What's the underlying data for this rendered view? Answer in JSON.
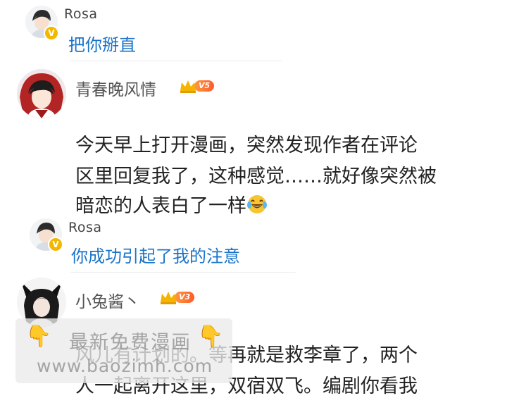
{
  "replies": [
    {
      "author": "Rosa",
      "text": "把你掰直"
    },
    {
      "author": "Rosa",
      "text": "你成功引起了我的注意"
    }
  ],
  "comments": [
    {
      "author": "青春晚风情",
      "rank_badge": "V5",
      "lines": [
        "今天早上打开漫画，突然发现作者在评论",
        "区里回复我了，这种感觉……就好像突然被",
        "暗恋的人表白了一样"
      ],
      "emoji": "laughing-tears"
    },
    {
      "author": "小兔酱丶",
      "rank_badge": "V3",
      "lines": [
        "风儿有计划的。等再就是救李章了，两个",
        "人一起离开这里，双宿双飞。编剧你看我"
      ]
    }
  ],
  "watermark": {
    "line1": "最新免费漫画",
    "line2": "www.baozimh.com"
  },
  "colors": {
    "reply_text": "#1a73c8",
    "verified_badge": "#f4b700",
    "rank_badge": "#ff7a33"
  }
}
